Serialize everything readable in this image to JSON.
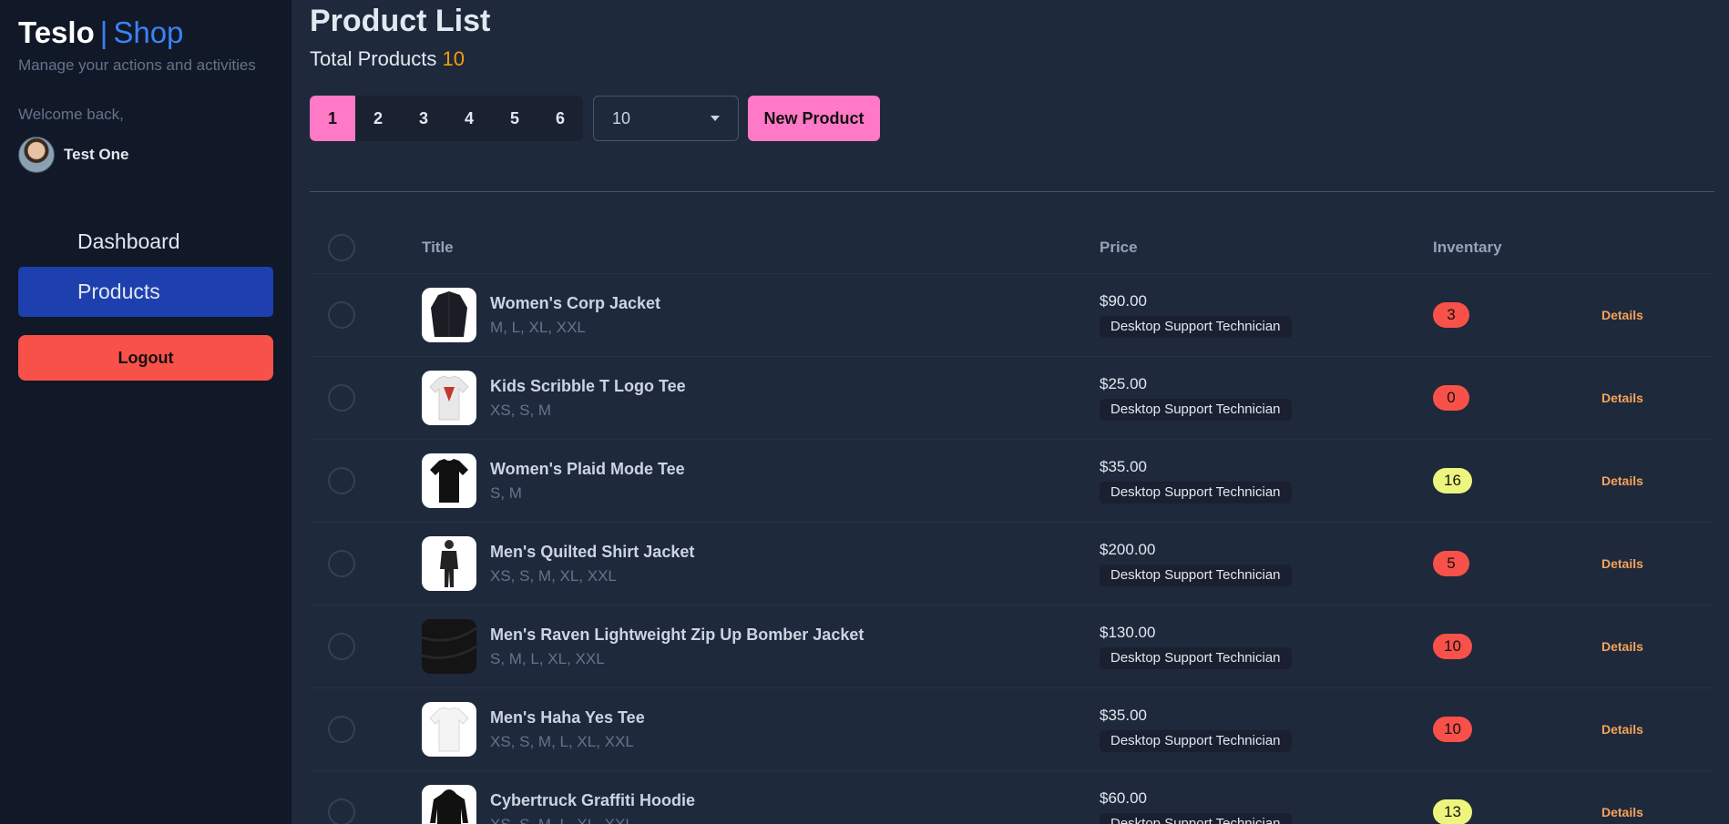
{
  "sidebar": {
    "brand_main": "Teslo",
    "brand_sep": "|",
    "brand_accent": "Shop",
    "subtitle": "Manage your actions and activities",
    "welcome": "Welcome back,",
    "username": "Test One",
    "nav": [
      "Dashboard",
      "Products"
    ],
    "logout": "Logout"
  },
  "main": {
    "title": "Product List",
    "total_label": "Total Products",
    "total_count": "10",
    "pages": [
      "1",
      "2",
      "3",
      "4",
      "5",
      "6"
    ],
    "per_page": "10",
    "new_product": "New Product"
  },
  "table": {
    "headers": {
      "title": "Title",
      "price": "Price",
      "inventory": "Inventary"
    },
    "details_label": "Details",
    "rows": [
      {
        "title": "Women's Corp Jacket",
        "sizes": "M, L, XL, XXL",
        "price": "$90.00",
        "role": "Desktop Support Technician",
        "inventory": "3",
        "status": "low",
        "image": "jacket-image"
      },
      {
        "title": "Kids Scribble T Logo Tee",
        "sizes": "XS, S, M",
        "price": "$25.00",
        "role": "Desktop Support Technician",
        "inventory": "0",
        "status": "low",
        "image": "tee-image"
      },
      {
        "title": "Women's Plaid Mode Tee",
        "sizes": "S, M",
        "price": "$35.00",
        "role": "Desktop Support Technician",
        "inventory": "16",
        "status": "ok",
        "image": "tee-image"
      },
      {
        "title": "Men's Quilted Shirt Jacket",
        "sizes": "XS, S, M, XL, XXL",
        "price": "$200.00",
        "role": "Desktop Support Technician",
        "inventory": "5",
        "status": "low",
        "image": "person-image"
      },
      {
        "title": "Men's Raven Lightweight Zip Up Bomber Jacket",
        "sizes": "S, M, L, XL, XXL",
        "price": "$130.00",
        "role": "Desktop Support Technician",
        "inventory": "10",
        "status": "low",
        "image": "fabric-image"
      },
      {
        "title": "Men's Haha Yes Tee",
        "sizes": "XS, S, M, L, XL, XXL",
        "price": "$35.00",
        "role": "Desktop Support Technician",
        "inventory": "10",
        "status": "low",
        "image": "tee-image"
      },
      {
        "title": "Cybertruck Graffiti Hoodie",
        "sizes": "XS, S, M, L, XL, XXL",
        "price": "$60.00",
        "role": "Desktop Support Technician",
        "inventory": "13",
        "status": "ok",
        "image": "hoodie-image"
      }
    ]
  },
  "colors": {
    "accent": "#3b82f6",
    "pink": "#ff79c6",
    "danger": "#f85149",
    "warning": "#eef57e",
    "details": "#f6a35b"
  }
}
